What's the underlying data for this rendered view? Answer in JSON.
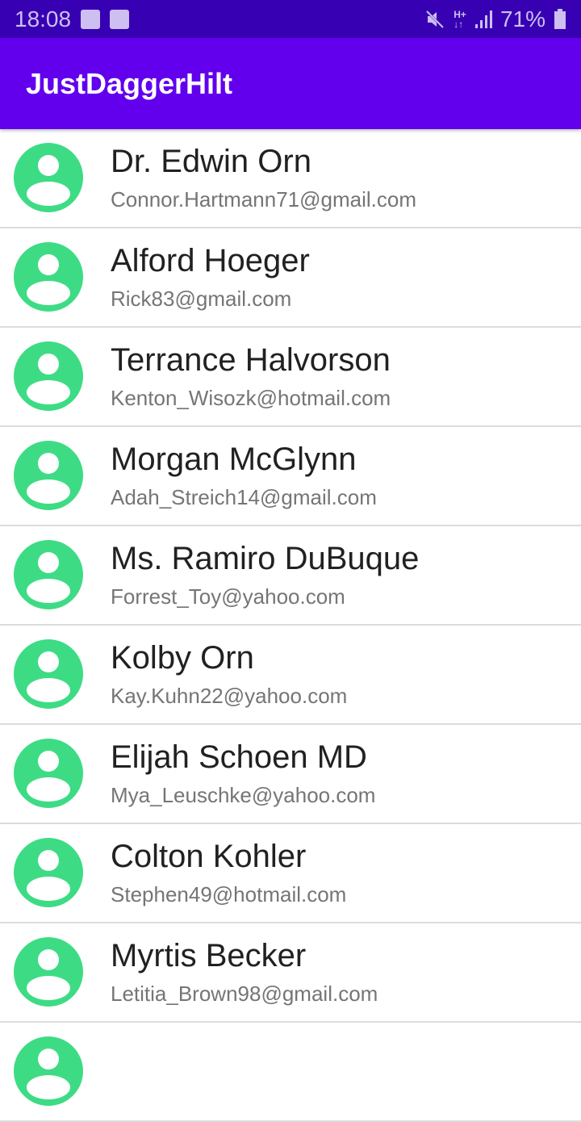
{
  "status_bar": {
    "time": "18:08",
    "battery": "71%",
    "icons": [
      "image-icon",
      "wifi-icon",
      "mute-icon",
      "hplus-icon",
      "signal-icon",
      "battery-icon"
    ]
  },
  "app_bar": {
    "title": "JustDaggerHilt"
  },
  "colors": {
    "status": "#3700b3",
    "primary": "#6200ee",
    "avatar": "#3ddc84"
  },
  "contacts": [
    {
      "name": "Dr. Edwin Orn",
      "email": "Connor.Hartmann71@gmail.com"
    },
    {
      "name": "Alford Hoeger",
      "email": "Rick83@gmail.com"
    },
    {
      "name": "Terrance Halvorson",
      "email": "Kenton_Wisozk@hotmail.com"
    },
    {
      "name": "Morgan McGlynn",
      "email": "Adah_Streich14@gmail.com"
    },
    {
      "name": "Ms. Ramiro DuBuque",
      "email": "Forrest_Toy@yahoo.com"
    },
    {
      "name": "Kolby Orn",
      "email": "Kay.Kuhn22@yahoo.com"
    },
    {
      "name": "Elijah Schoen MD",
      "email": "Mya_Leuschke@yahoo.com"
    },
    {
      "name": "Colton Kohler",
      "email": "Stephen49@hotmail.com"
    },
    {
      "name": "Myrtis Becker",
      "email": "Letitia_Brown98@gmail.com"
    }
  ]
}
